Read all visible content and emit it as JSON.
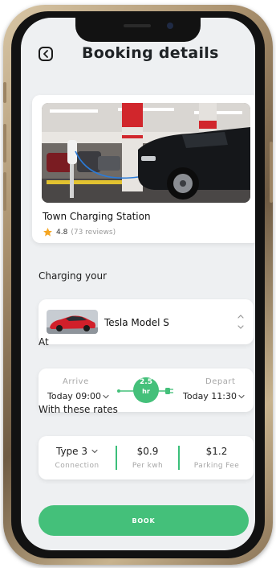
{
  "header": {
    "title": "Booking details"
  },
  "station": {
    "name": "Town Charging Station",
    "rating": "4.8",
    "reviews": "(73 reviews)"
  },
  "vehicle": {
    "section_label": "Charging your",
    "name": "Tesla Model S"
  },
  "schedule": {
    "section_label": "At",
    "arrive_label": "Arrive",
    "arrive_value": "Today 09:00",
    "duration_value": "2.5",
    "duration_unit": "hr",
    "depart_label": "Depart",
    "depart_value": "Today 11:30"
  },
  "rates": {
    "section_label": "With these rates",
    "connection_value": "Type 3",
    "connection_caption": "Connection",
    "per_kwh_value": "$0.9",
    "per_kwh_caption": "Per kwh",
    "parking_value": "$1.2",
    "parking_caption": "Parking Fee"
  },
  "actions": {
    "book_label": "BOOK"
  },
  "colors": {
    "accent": "#44c07a",
    "background": "#eef0f2",
    "star": "#f5a623",
    "vehicle": "#d11f2a"
  }
}
